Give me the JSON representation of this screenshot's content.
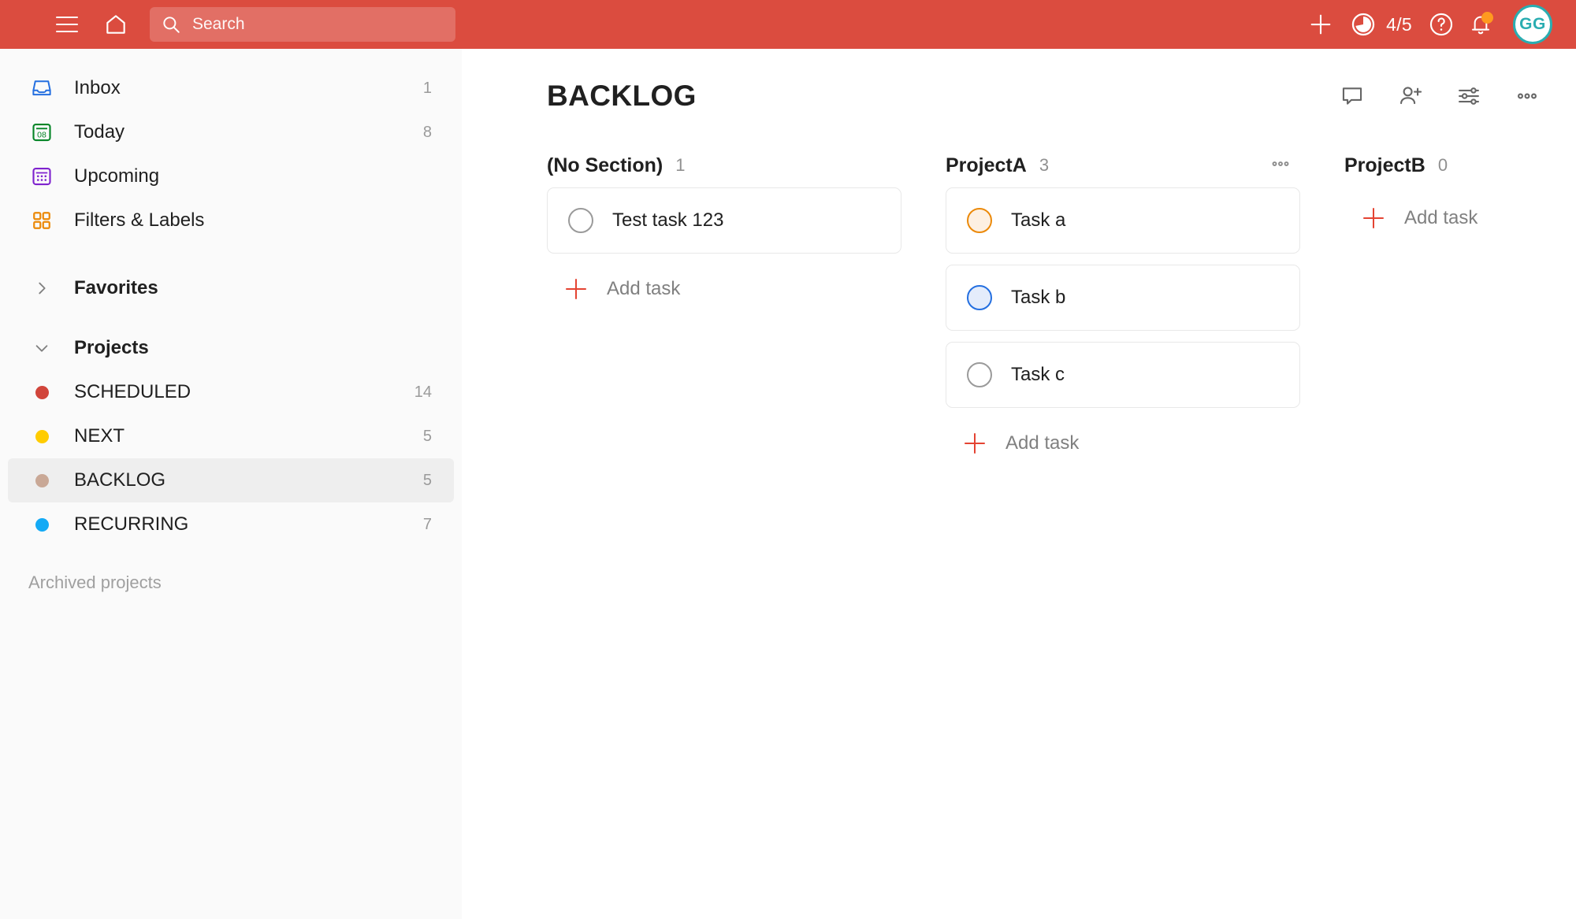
{
  "topbar": {
    "menu_icon": "hamburger-menu-icon",
    "home_icon": "home-icon",
    "search": {
      "placeholder": "Search",
      "value": ""
    },
    "add_icon": "plus-icon",
    "productivity": {
      "icon": "productivity-pie-icon",
      "count": "4/5"
    },
    "help_icon": "help-circle-icon",
    "notifications_icon": "bell-icon",
    "avatar": {
      "initials": "GG"
    },
    "background_color": "#db4c3f"
  },
  "sidebar": {
    "nav": [
      {
        "label": "Inbox",
        "count": "1",
        "icon": "inbox-icon",
        "color": "#246fe0"
      },
      {
        "label": "Today",
        "count": "8",
        "icon": "calendar-today-icon",
        "color": "#058527",
        "day": "08"
      },
      {
        "label": "Upcoming",
        "count": "",
        "icon": "calendar-grid-icon",
        "color": "#7e22ce"
      },
      {
        "label": "Filters & Labels",
        "count": "",
        "icon": "filters-labels-icon",
        "color": "#eb8909"
      }
    ],
    "favorites": {
      "label": "Favorites",
      "expanded": false,
      "chevron": "chevron-right-icon"
    },
    "projects_header": {
      "label": "Projects",
      "expanded": true,
      "chevron": "chevron-down-icon"
    },
    "projects": [
      {
        "label": "SCHEDULED",
        "count": "14",
        "color": "#d1453b",
        "active": false
      },
      {
        "label": "NEXT",
        "count": "5",
        "color": "#ffcc00",
        "active": false
      },
      {
        "label": "BACKLOG",
        "count": "5",
        "color": "#c9a896",
        "active": true
      },
      {
        "label": "RECURRING",
        "count": "7",
        "color": "#14aaf5",
        "active": false
      }
    ],
    "archived_label": "Archived projects"
  },
  "main": {
    "title": "BACKLOG",
    "tools": [
      {
        "name": "comments-icon"
      },
      {
        "name": "add-person-icon"
      },
      {
        "name": "view-options-icon"
      },
      {
        "name": "more-options-icon"
      }
    ],
    "add_task_label": "Add task",
    "columns": [
      {
        "name": "(No Section)",
        "count": "1",
        "has_menu": false,
        "tasks": [
          {
            "text": "Test task 123",
            "priority": "p4"
          }
        ]
      },
      {
        "name": "ProjectA",
        "count": "3",
        "has_menu": true,
        "tasks": [
          {
            "text": "Task a",
            "priority": "p2"
          },
          {
            "text": "Task b",
            "priority": "p3"
          },
          {
            "text": "Task c",
            "priority": "p4"
          }
        ]
      },
      {
        "name": "ProjectB",
        "count": "0",
        "has_menu": false,
        "tasks": []
      }
    ]
  }
}
